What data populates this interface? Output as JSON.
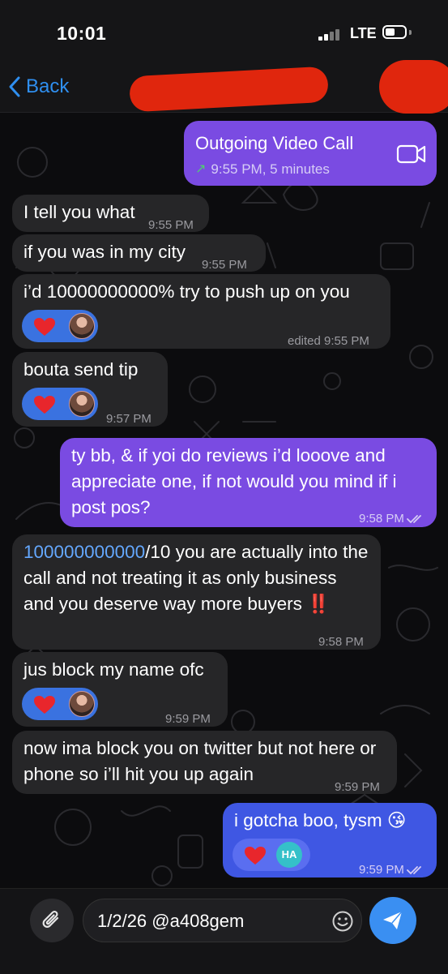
{
  "status_bar": {
    "time": "10:01",
    "network": "LTE"
  },
  "nav": {
    "back_label": "Back"
  },
  "messages": [
    {
      "id": "call",
      "direction": "out",
      "title": "Outgoing Video Call",
      "subtitle": "9:55 PM, 5 minutes",
      "icon": "video-camera-icon"
    },
    {
      "id": "m1",
      "direction": "in",
      "text": "I tell you what",
      "time": "9:55 PM"
    },
    {
      "id": "m2",
      "direction": "in",
      "text": "if you was in my city",
      "time": "9:55 PM"
    },
    {
      "id": "m3",
      "direction": "in",
      "text": "i’d 10000000000% try to push up on you",
      "time": "edited 9:55 PM",
      "reaction": "heart-with-avatar"
    },
    {
      "id": "m4",
      "direction": "in",
      "text": "bouta send tip",
      "time": "9:57 PM",
      "reaction": "heart-with-avatar"
    },
    {
      "id": "m5",
      "direction": "out",
      "text": "ty bb, & if yoi do reviews i’d looove and appreciate one, if not would you mind if i post pos?",
      "time": "9:58 PM",
      "read": true
    },
    {
      "id": "m6",
      "direction": "in",
      "highlight": "100000000000",
      "text": "/10 you are actually into the call and not treating it as only business and you deserve way more buyers ",
      "emoji": "‼️",
      "time": "9:58 PM"
    },
    {
      "id": "m7",
      "direction": "in",
      "text": "jus block my name ofc",
      "time": "9:59 PM",
      "reaction": "heart-with-avatar"
    },
    {
      "id": "m8",
      "direction": "in",
      "text": "now ima block you on twitter but not here or phone so i’ll hit you up again",
      "time": "9:59 PM"
    },
    {
      "id": "m9",
      "direction": "out",
      "text": "i gotcha boo, tysm 😘",
      "time": "9:59 PM",
      "read": true,
      "reaction_initials": "HA"
    }
  ],
  "input": {
    "value": "1/2/26 @a408gem"
  },
  "colors": {
    "accent": "#2f8ff0",
    "outgoing_bubble": "#7a4be2",
    "incoming_bubble": "#262628",
    "reaction_heart": "#e8262c",
    "redaction": "#e0260d"
  }
}
